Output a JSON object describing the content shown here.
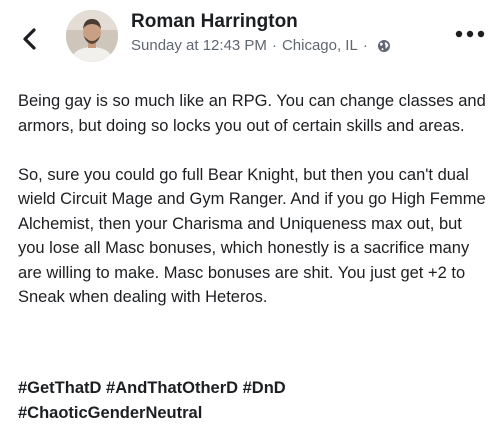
{
  "header": {
    "back_icon": "chevron-left-icon",
    "author_name": "Roman Harrington",
    "timestamp": "Sunday at 12:43 PM",
    "separator": "·",
    "location": "Chicago, IL",
    "privacy_icon": "globe-icon",
    "more_icon": "more-horizontal-icon"
  },
  "post": {
    "paragraphs": [
      "Being gay is so much like an RPG. You can change classes and armors, but doing so locks you out of certain skills and areas.",
      "So, sure you could go full Bear Knight, but then you can't dual wield Circuit Mage and Gym Ranger. And if you go High Femme Alchemist, then your Charisma and Uniqueness max out, but you lose all Masc bonuses, which honestly is a sacrifice many are willing to make. Masc bonuses are shit. You just get +2 to Sneak when dealing with Heteros."
    ],
    "hashtags": [
      "#GetThatD",
      "#AndThatOtherD",
      "#DnD",
      "#ChaoticGenderNeutral"
    ]
  },
  "colors": {
    "text": "#1c1e21",
    "meta_text": "#606770",
    "background": "#ffffff"
  }
}
